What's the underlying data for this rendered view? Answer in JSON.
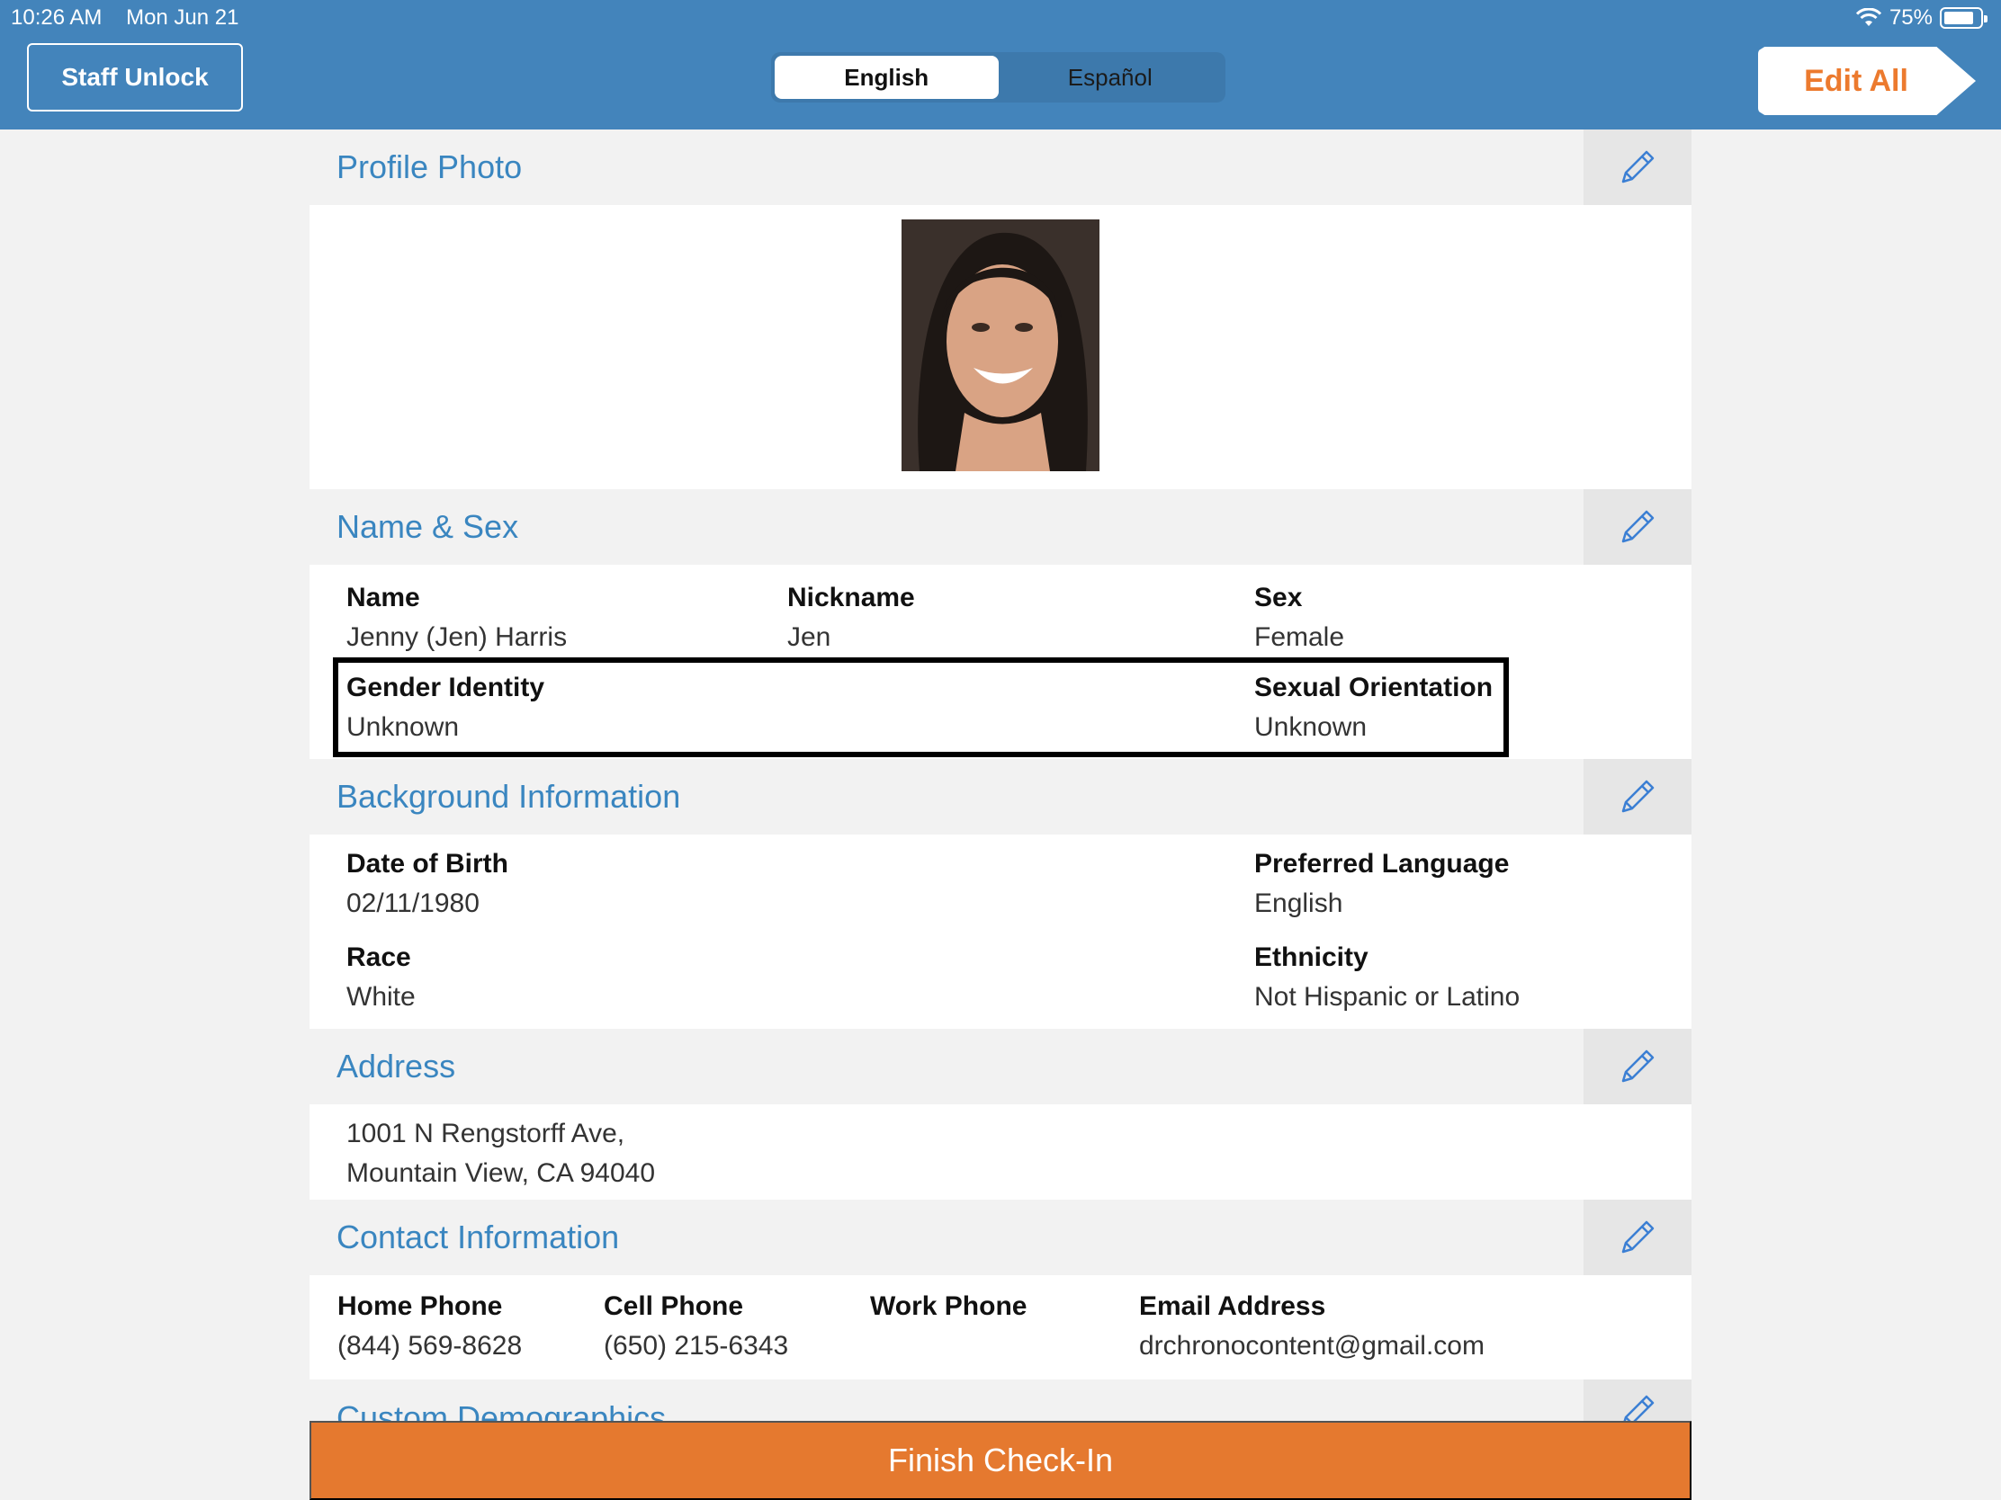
{
  "status_bar": {
    "time": "10:26 AM",
    "date": "Mon Jun 21",
    "battery": "75%",
    "battery_level": 0.75
  },
  "header": {
    "staff_unlock": "Staff Unlock",
    "languages": [
      "English",
      "Español"
    ],
    "active_language": "English",
    "edit_all": "Edit All"
  },
  "sections": {
    "profile_photo": {
      "title": "Profile Photo"
    },
    "name_sex": {
      "title": "Name & Sex",
      "name": {
        "label": "Name",
        "value": "Jenny (Jen) Harris"
      },
      "nickname": {
        "label": "Nickname",
        "value": "Jen"
      },
      "sex": {
        "label": "Sex",
        "value": "Female"
      },
      "gender_identity": {
        "label": "Gender Identity",
        "value": "Unknown"
      },
      "sexual_orientation": {
        "label": "Sexual Orientation",
        "value": "Unknown"
      }
    },
    "background": {
      "title": "Background Information",
      "dob": {
        "label": "Date of Birth",
        "value": "02/11/1980"
      },
      "preferred_language": {
        "label": "Preferred Language",
        "value": "English"
      },
      "race": {
        "label": "Race",
        "value": "White"
      },
      "ethnicity": {
        "label": "Ethnicity",
        "value": "Not Hispanic or Latino"
      }
    },
    "address": {
      "title": "Address",
      "line1": "1001 N Rengstorff Ave,",
      "line2": "Mountain View, CA 94040"
    },
    "contact": {
      "title": "Contact Information",
      "home_phone": {
        "label": "Home Phone",
        "value": "(844) 569-8628"
      },
      "cell_phone": {
        "label": "Cell Phone",
        "value": "(650) 215-6343"
      },
      "work_phone": {
        "label": "Work Phone",
        "value": ""
      },
      "email": {
        "label": "Email Address",
        "value": "drchronocontent@gmail.com"
      }
    },
    "custom": {
      "title": "Custom Demographics"
    }
  },
  "footer": {
    "finish": "Finish Check-In"
  },
  "colors": {
    "header_bg": "#4384bb",
    "accent_orange": "#e5792f",
    "section_title": "#3a86c0"
  }
}
